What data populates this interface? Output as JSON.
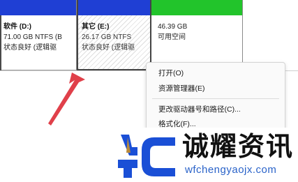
{
  "partitions": [
    {
      "name": "软件 (D:)",
      "size": "71.00 GB NTFS (B",
      "status": "状态良好 (逻辑驱",
      "bar_color": "#1f3fd4"
    },
    {
      "name": "其它 (E:)",
      "size": "26.17 GB NTFS",
      "status": "状态良好 (逻辑驱",
      "bar_color": "#1f3fd4",
      "selected": true
    },
    {
      "name": "",
      "size": "46.39 GB",
      "status": "可用空间",
      "bar_color": "#22c42b"
    }
  ],
  "context_menu": {
    "items": [
      {
        "label": "打开(O)"
      },
      {
        "label": "资源管理器(E)"
      },
      {
        "label": "更改驱动器号和路径(C)..."
      },
      {
        "label": "格式化(F)..."
      }
    ]
  },
  "annotation": {
    "arrow_color": "#e0404a",
    "icon": "red-arrow-icon"
  },
  "watermark": {
    "title": "诚耀资讯",
    "url": "wfchengyaojx.com",
    "logo_icon": "yc-logo-icon",
    "logo_color": "#1a4fd6"
  }
}
